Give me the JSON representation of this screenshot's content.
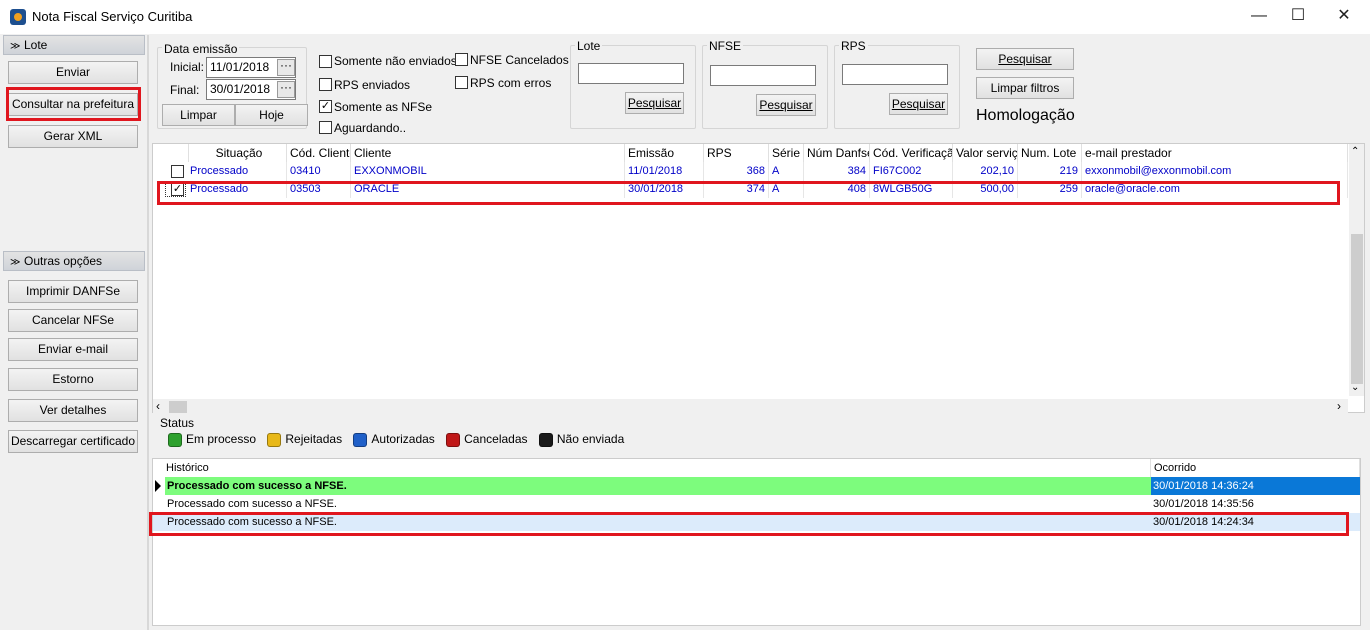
{
  "window": {
    "title": "Nota Fiscal Serviço Curitiba",
    "minimize": "—",
    "maximize": "☐",
    "close": "✕"
  },
  "sidebar": {
    "lote_header": "Lote",
    "lote_buttons": [
      "Enviar",
      "Consultar na prefeitura",
      "Gerar XML"
    ],
    "outras_header": "Outras opções",
    "outras_buttons": [
      "Imprimir DANFSe",
      "Cancelar NFSe",
      "Enviar e-mail",
      "Estorno",
      "Ver detalhes",
      "Descarregar certificado"
    ]
  },
  "filters": {
    "data_emissao": {
      "label": "Data emissão",
      "inicial_label": "Inicial:",
      "inicial_value": "11/01/2018",
      "final_label": "Final:",
      "final_value": "30/01/2018",
      "limpar": "Limpar",
      "hoje": "Hoje"
    },
    "checks": [
      {
        "label": "Somente não enviados",
        "checked": false
      },
      {
        "label": "RPS enviados",
        "checked": false
      },
      {
        "label": "Somente as NFSe",
        "checked": true
      },
      {
        "label": "Aguardando..",
        "checked": false
      },
      {
        "label": "NFSE Cancelados",
        "checked": false
      },
      {
        "label": "RPS com erros",
        "checked": false
      }
    ],
    "lote": {
      "label": "Lote",
      "value": "",
      "button": "Pesquisar"
    },
    "nfse": {
      "label": "NFSE",
      "value": "",
      "button": "Pesquisar"
    },
    "rps": {
      "label": "RPS",
      "value": "",
      "button": "Pesquisar"
    },
    "pesquisar": "Pesquisar",
    "limpar_filtros": "Limpar filtros",
    "ambiente": "Homologação"
  },
  "grid": {
    "columns": [
      "Situação",
      "Cód. Cliente",
      "Cliente",
      "Emissão",
      "RPS",
      "Série",
      "Núm Danfse",
      "Cód. Verificação",
      "Valor serviço",
      "Num. Lote",
      "e-mail prestador"
    ],
    "rows": [
      {
        "checked": false,
        "situacao": "Processado",
        "cod_cliente": "03410",
        "cliente": "EXXONMOBIL",
        "emissao": "11/01/2018",
        "rps": "368",
        "serie": "A",
        "num_danfse": "384",
        "cod_verificacao": "FI67C002",
        "valor": "202,10",
        "num_lote": "219",
        "email": "exxonmobil@exxonmobil.com"
      },
      {
        "checked": true,
        "situacao": "Processado",
        "cod_cliente": "03503",
        "cliente": "ORACLE",
        "emissao": "30/01/2018",
        "rps": "374",
        "serie": "A",
        "num_danfse": "408",
        "cod_verificacao": "8WLGB50G",
        "valor": "500,00",
        "num_lote": "259",
        "email": "oracle@oracle.com"
      }
    ]
  },
  "status": {
    "label": "Status",
    "items": [
      {
        "label": "Em processo",
        "color": "#2ea12e"
      },
      {
        "label": "Rejeitadas",
        "color": "#e8b818"
      },
      {
        "label": "Autorizadas",
        "color": "#2060c8"
      },
      {
        "label": "Canceladas",
        "color": "#c01818"
      },
      {
        "label": "Não enviada",
        "color": "#1a1a1a"
      }
    ]
  },
  "historico": {
    "columns": [
      "Histórico",
      "Ocorrido"
    ],
    "rows": [
      {
        "text": "Processado com sucesso a NFSE.",
        "date": "30/01/2018 14:36:24"
      },
      {
        "text": "Processado com sucesso a NFSE.",
        "date": "30/01/2018 14:35:56"
      },
      {
        "text": "Processado com sucesso a NFSE.",
        "date": "30/01/2018 14:24:34"
      }
    ]
  }
}
